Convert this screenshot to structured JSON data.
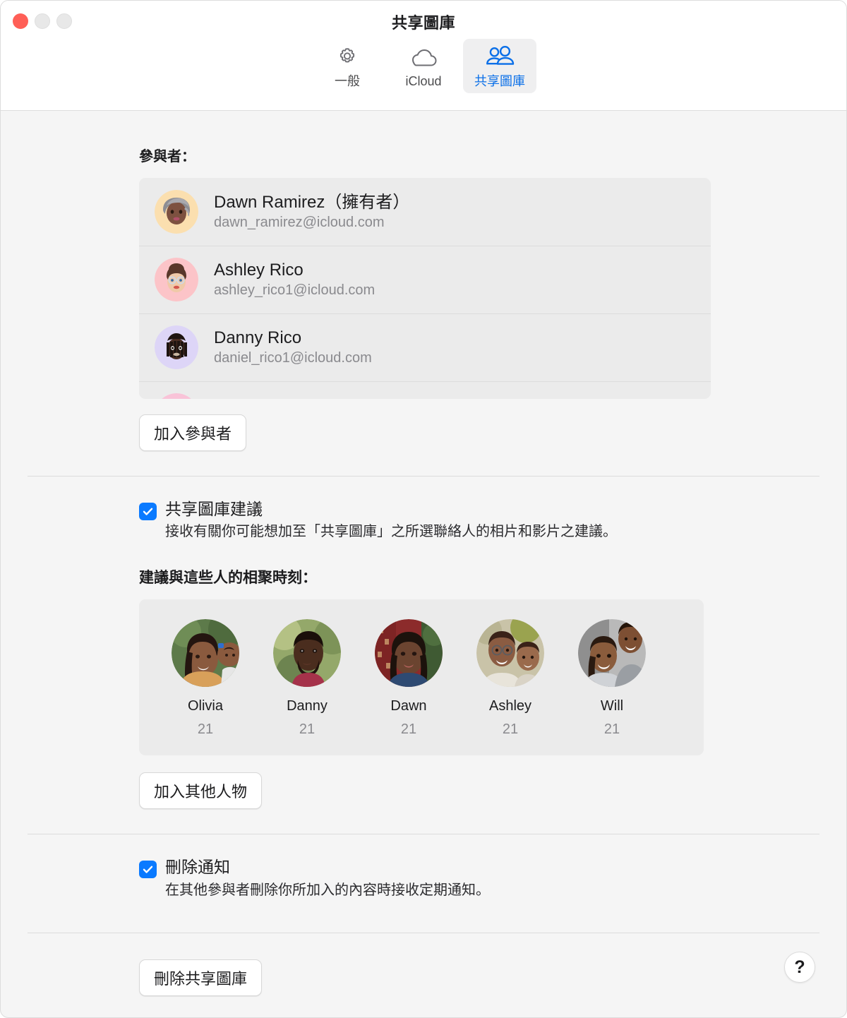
{
  "window": {
    "title": "共享圖庫",
    "traffic_lights": [
      "close",
      "minimize",
      "maximize"
    ]
  },
  "tabs": [
    {
      "label": "一般",
      "icon": "gear-icon",
      "selected": false
    },
    {
      "label": "iCloud",
      "icon": "cloud-icon",
      "selected": false
    },
    {
      "label": "共享圖庫",
      "icon": "people-icon",
      "selected": true
    }
  ],
  "participants_section": {
    "label": "參與者：",
    "rows": [
      {
        "name": "Dawn Ramirez（擁有者）",
        "email": "dawn_ramirez@icloud.com",
        "avatar": "memoji-dawn",
        "avatar_bg": "#fbdfaf"
      },
      {
        "name": "Ashley Rico",
        "email": "ashley_rico1@icloud.com",
        "avatar": "memoji-ashley",
        "avatar_bg": "#fcc4c8"
      },
      {
        "name": "Danny Rico",
        "email": "daniel_rico1@icloud.com",
        "avatar": "memoji-danny",
        "avatar_bg": "#ddd5f7"
      },
      {
        "name": "",
        "email": "",
        "avatar": "memoji-partial",
        "avatar_bg": "#f9c3d8"
      }
    ],
    "add_button": "加入參與者"
  },
  "suggestions_section": {
    "checkbox_checked": true,
    "title": "共享圖庫建議",
    "description": "接收有關你可能想加至「共享圖庫」之所選聯絡人的相片和影片之建議。",
    "people_label": "建議與這些人的相聚時刻：",
    "people": [
      {
        "name": "Olivia",
        "count": "21"
      },
      {
        "name": "Danny",
        "count": "21"
      },
      {
        "name": "Dawn",
        "count": "21"
      },
      {
        "name": "Ashley",
        "count": "21"
      },
      {
        "name": "Will",
        "count": "21"
      }
    ],
    "add_people_button": "加入其他人物"
  },
  "notifications_section": {
    "checkbox_checked": true,
    "title": "刪除通知",
    "description": "在其他參與者刪除你所加入的內容時接收定期通知。"
  },
  "footer": {
    "delete_button": "刪除共享圖庫",
    "help_button": "?"
  },
  "colors": {
    "accent_blue": "#0a7aff",
    "tab_blue": "#0a6fe8",
    "close_red": "#ff5f57",
    "window_bg": "#f5f5f5",
    "toolbar_bg": "#ffffff",
    "list_bg": "#ebebeb"
  }
}
